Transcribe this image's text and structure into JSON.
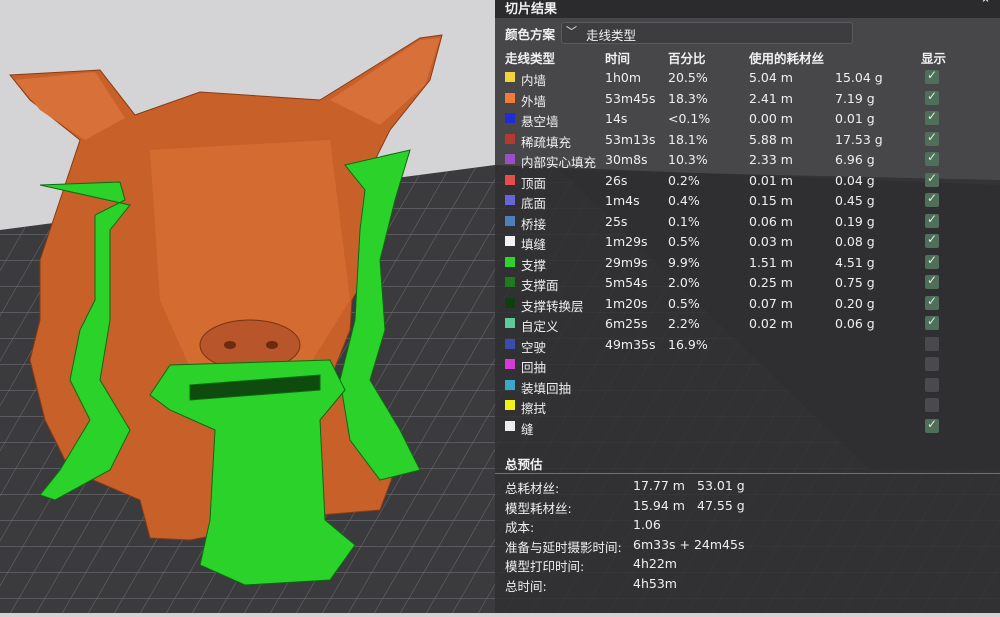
{
  "panel": {
    "title": "切片结果",
    "collapse_icon": "double-chevron-up-icon",
    "color_scheme_label": "颜色方案",
    "color_scheme_value": "走线类型",
    "columns": {
      "type": "走线类型",
      "time": "时间",
      "percent": "百分比",
      "filament": "使用的耗材丝",
      "show": "显示"
    },
    "rows": [
      {
        "label": "内墙",
        "color": "#f2d33e",
        "time": "1h0m",
        "percent": "20.5%",
        "length": "5.04 m",
        "weight": "15.04 g",
        "shown": true
      },
      {
        "label": "外墙",
        "color": "#f07a3a",
        "time": "53m45s",
        "percent": "18.3%",
        "length": "2.41 m",
        "weight": "7.19 g",
        "shown": true
      },
      {
        "label": "悬空墙",
        "color": "#1f2bd8",
        "time": "14s",
        "percent": "<0.1%",
        "length": "0.00 m",
        "weight": "0.01 g",
        "shown": true
      },
      {
        "label": "稀疏填充",
        "color": "#b33a30",
        "time": "53m13s",
        "percent": "18.1%",
        "length": "5.88 m",
        "weight": "17.53 g",
        "shown": true
      },
      {
        "label": "内部实心填充",
        "color": "#9b4fc7",
        "time": "30m8s",
        "percent": "10.3%",
        "length": "2.33 m",
        "weight": "6.96 g",
        "shown": true
      },
      {
        "label": "顶面",
        "color": "#e84b4b",
        "time": "26s",
        "percent": "0.2%",
        "length": "0.01 m",
        "weight": "0.04 g",
        "shown": true
      },
      {
        "label": "底面",
        "color": "#6666d8",
        "time": "1m4s",
        "percent": "0.4%",
        "length": "0.15 m",
        "weight": "0.45 g",
        "shown": true
      },
      {
        "label": "桥接",
        "color": "#4f7fb8",
        "time": "25s",
        "percent": "0.1%",
        "length": "0.06 m",
        "weight": "0.19 g",
        "shown": true
      },
      {
        "label": "填缝",
        "color": "#f2f2f2",
        "time": "1m29s",
        "percent": "0.5%",
        "length": "0.03 m",
        "weight": "0.08 g",
        "shown": true
      },
      {
        "label": "支撑",
        "color": "#2cd42c",
        "time": "29m9s",
        "percent": "9.9%",
        "length": "1.51 m",
        "weight": "4.51 g",
        "shown": true
      },
      {
        "label": "支撑面",
        "color": "#1f7a1f",
        "time": "5m54s",
        "percent": "2.0%",
        "length": "0.25 m",
        "weight": "0.75 g",
        "shown": true
      },
      {
        "label": "支撑转换层",
        "color": "#0f3f0f",
        "time": "1m20s",
        "percent": "0.5%",
        "length": "0.07 m",
        "weight": "0.20 g",
        "shown": true
      },
      {
        "label": "自定义",
        "color": "#5ec99a",
        "time": "6m25s",
        "percent": "2.2%",
        "length": "0.02 m",
        "weight": "0.06 g",
        "shown": true
      },
      {
        "label": "空驶",
        "color": "#3a4cab",
        "time": "49m35s",
        "percent": "16.9%",
        "length": "",
        "weight": "",
        "shown": false
      },
      {
        "label": "回抽",
        "color": "#d63ad6",
        "time": "",
        "percent": "",
        "length": "",
        "weight": "",
        "shown": false
      },
      {
        "label": "装填回抽",
        "color": "#3aa6c9",
        "time": "",
        "percent": "",
        "length": "",
        "weight": "",
        "shown": false
      },
      {
        "label": "擦拭",
        "color": "#f2f21a",
        "time": "",
        "percent": "",
        "length": "",
        "weight": "",
        "shown": false
      },
      {
        "label": "缝",
        "color": "#ececec",
        "time": "",
        "percent": "",
        "length": "",
        "weight": "",
        "shown": true
      }
    ],
    "summary": {
      "title": "总预估",
      "rows": [
        {
          "label": "总耗材丝:",
          "v1": "17.77 m",
          "v2": "53.01 g"
        },
        {
          "label": "模型耗材丝:",
          "v1": "15.94 m",
          "v2": "47.55 g"
        },
        {
          "label": "成本:",
          "v1": "1.06",
          "v2": ""
        },
        {
          "label": "准备与延时摄影时间:",
          "v1": "6m33s + 24m45s",
          "v2": ""
        },
        {
          "label": "模型打印时间:",
          "v1": "4h22m",
          "v2": ""
        },
        {
          "label": "总时间:",
          "v1": "4h53m",
          "v2": ""
        }
      ]
    }
  }
}
